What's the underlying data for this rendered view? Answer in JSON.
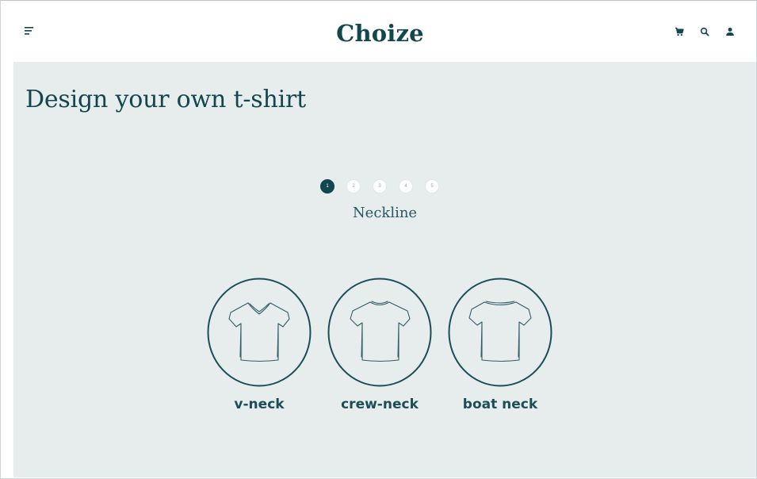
{
  "header": {
    "brand": "Choize",
    "icons": [
      "menu-icon",
      "cart-icon",
      "search-icon",
      "user-icon"
    ]
  },
  "main": {
    "title": "Design your own t-shirt",
    "stepper": {
      "steps": [
        "1",
        "2",
        "3",
        "4",
        "5"
      ],
      "active_index": 0,
      "current_label": "Neckline"
    },
    "options": [
      {
        "label": "v-neck",
        "icon": "v-neck-tshirt-icon"
      },
      {
        "label": "crew-neck",
        "icon": "crew-neck-tshirt-icon"
      },
      {
        "label": "boat neck",
        "icon": "boat-neck-tshirt-icon"
      }
    ]
  },
  "colors": {
    "brand": "#12474f",
    "background": "#e7ecec",
    "header": "#ffffff"
  }
}
